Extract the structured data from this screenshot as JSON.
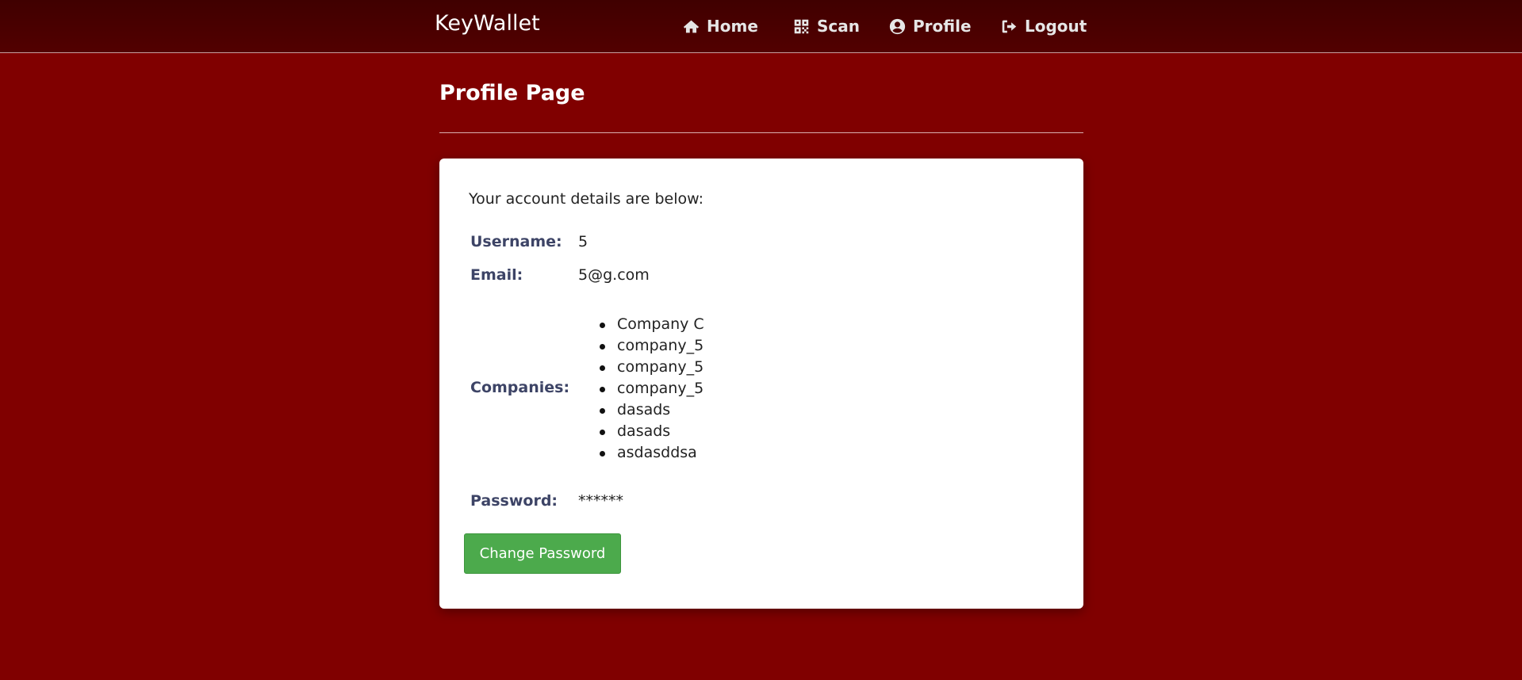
{
  "navbar": {
    "brand": "KeyWallet",
    "links": [
      {
        "label": "Home",
        "icon": "home-icon"
      },
      {
        "label": "Scan",
        "icon": "qr-code-icon"
      },
      {
        "label": "Profile",
        "icon": "user-circle-icon"
      },
      {
        "label": "Logout",
        "icon": "sign-out-icon"
      }
    ]
  },
  "page": {
    "title": "Profile Page"
  },
  "card": {
    "intro": "Your account details are below:",
    "username_label": "Username:",
    "username_value": "5",
    "email_label": "Email:",
    "email_value": "5@g.com",
    "companies_label": "Companies:",
    "companies": [
      "Company C",
      "company_5",
      "company_5",
      "company_5",
      "dasads",
      "dasads",
      "asdasddsa"
    ],
    "password_label": "Password:",
    "password_value": "******",
    "change_password_button": "Change Password"
  },
  "colors": {
    "background": "#800000",
    "navbar": "#4a0000",
    "button": "#4caa4c",
    "label": "#3d4466"
  }
}
